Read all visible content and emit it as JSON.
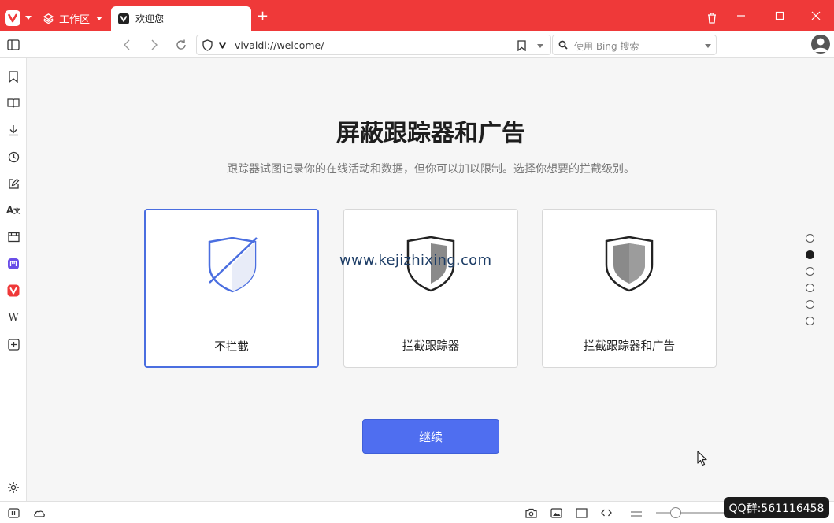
{
  "browser": {
    "workspace_label": "工作区",
    "tab_title": "欢迎您",
    "url": "vivaldi://welcome/",
    "search_placeholder": "使用 Bing 搜索"
  },
  "page": {
    "title": "屏蔽跟踪器和广告",
    "subtitle": "跟踪器试图记录你的在线活动和数据，但你可以加以限制。选择你想要的拦截级别。",
    "options": [
      {
        "label": "不拦截",
        "selected": true,
        "icon": "shield-off-icon"
      },
      {
        "label": "拦截跟踪器",
        "selected": false,
        "icon": "shield-half-icon"
      },
      {
        "label": "拦截跟踪器和广告",
        "selected": false,
        "icon": "shield-full-icon"
      }
    ],
    "continue_label": "继续",
    "step_total": 6,
    "step_current": 2,
    "watermark": "www.kejizhixing.com"
  },
  "overlay": {
    "qq_text": "QQ群:561116458"
  },
  "colors": {
    "titlebar": "#ef3939",
    "accent": "#4f6ef0",
    "selected_border": "#4a6ee0"
  }
}
